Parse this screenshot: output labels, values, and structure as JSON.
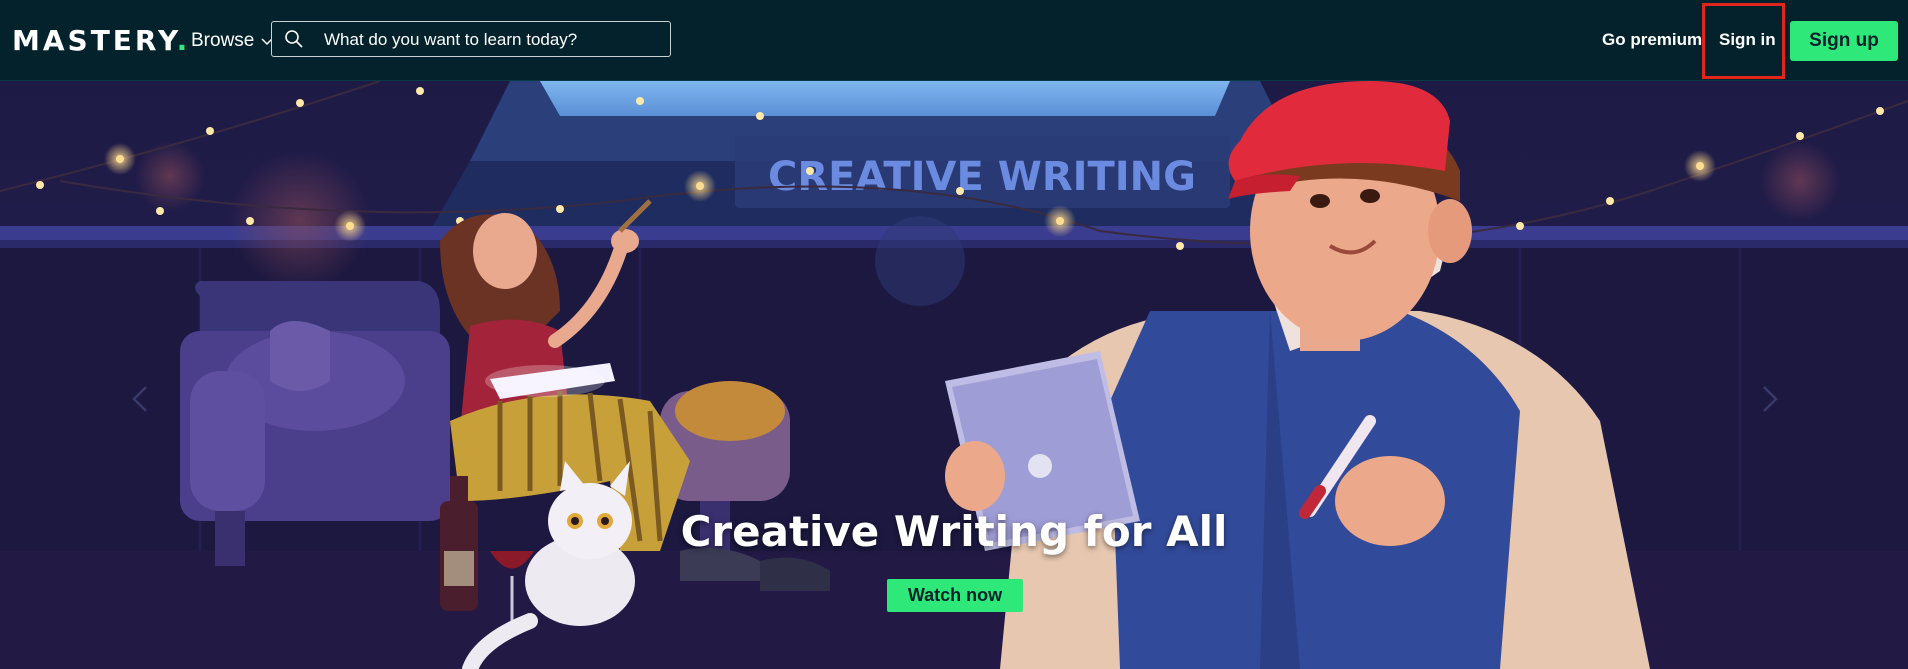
{
  "header": {
    "logo_text": "MASTERY",
    "logo_dot": ".",
    "browse_label": "Browse",
    "search_placeholder": "What do you want to learn today?",
    "go_premium_label": "Go premium",
    "sign_in_label": "Sign in",
    "sign_up_label": "Sign up"
  },
  "hero": {
    "banner_text": "CREATIVE WRITING",
    "title": "Creative Writing for All",
    "watch_label": "Watch now"
  },
  "colors": {
    "nav_bg": "#03222c",
    "accent_green": "#2ee87a",
    "highlight_red": "#e0261a"
  },
  "icons": [
    "search-icon",
    "chevron-down-icon",
    "chevron-left-icon",
    "chevron-right-icon"
  ]
}
